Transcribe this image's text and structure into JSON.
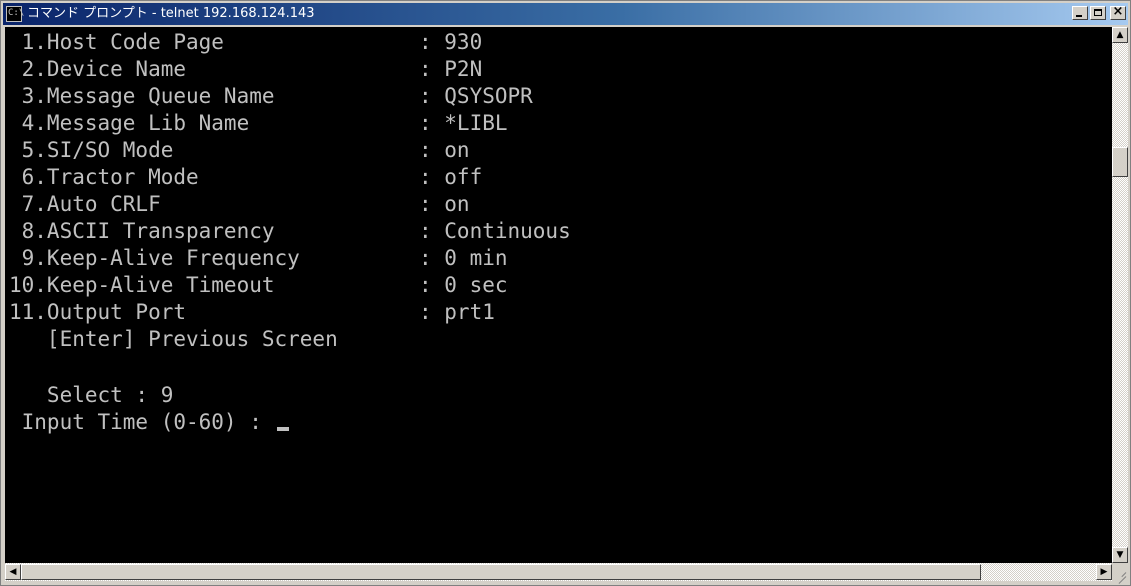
{
  "window": {
    "title": "コマンド プロンプト - telnet 192.168.124.143",
    "icon": "cmd-icon",
    "close_glyph": "×"
  },
  "console": {
    "menu": [
      {
        "label": " 1.Host Code Page",
        "value": ": 930"
      },
      {
        "label": " 2.Device Name",
        "value": ": P2N"
      },
      {
        "label": " 3.Message Queue Name",
        "value": ": QSYSOPR"
      },
      {
        "label": " 4.Message Lib Name",
        "value": ": *LIBL"
      },
      {
        "label": " 5.SI/SO Mode",
        "value": ": on"
      },
      {
        "label": " 6.Tractor Mode",
        "value": ": off"
      },
      {
        "label": " 7.Auto CRLF",
        "value": ": on"
      },
      {
        "label": " 8.ASCII Transparency",
        "value": ": Continuous"
      },
      {
        "label": " 9.Keep-Alive Frequency",
        "value": ": 0 min"
      },
      {
        "label": "10.Keep-Alive Timeout",
        "value": ": 0 sec"
      },
      {
        "label": "11.Output Port",
        "value": ": prt1"
      }
    ],
    "enter_hint": "   [Enter] Previous Screen",
    "select_line": "   Select : 9",
    "input_prompt": " Input Time (0-60) : "
  },
  "colors": {
    "console_bg": "#000000",
    "console_fg": "#c0c0c0",
    "titlebar_start": "#0a246a",
    "titlebar_end": "#a6caf0"
  }
}
